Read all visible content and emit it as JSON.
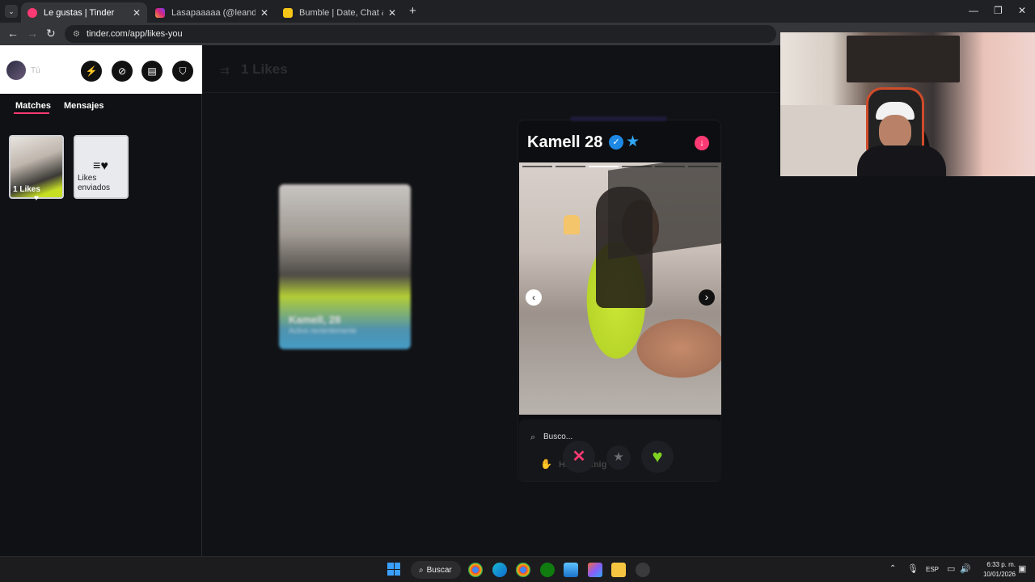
{
  "browser": {
    "tabs": [
      {
        "title": "Le gustas | Tinder",
        "active": true,
        "favicon_color": "#fd3a73"
      },
      {
        "title": "Lasapaaaaa (@leandroloaizam)",
        "active": false,
        "favicon_color": "#d62976"
      },
      {
        "title": "Bumble | Date, Chat & Meet Ne",
        "active": false,
        "favicon_color": "#f5c518"
      }
    ],
    "url": "tinder.com/app/likes-you",
    "new_tab_label": "+"
  },
  "sidebar": {
    "user_label": "Tú",
    "icons": [
      "bolt-icon",
      "compass-icon",
      "briefcase-icon",
      "shield-icon"
    ],
    "tabs": [
      {
        "label": "Matches",
        "active": true
      },
      {
        "label": "Mensajes",
        "active": false
      }
    ],
    "cards": [
      {
        "label": "1 Likes"
      },
      {
        "label": "Likes enviados"
      }
    ]
  },
  "main": {
    "likes_title": "1 Likes",
    "blurred_card": {
      "name": "Kamell, 28",
      "status": "Activo recientemente"
    }
  },
  "profile": {
    "name": "Kamell",
    "age": "28",
    "looking_for_label": "Busco...",
    "looking_for_value": "Hacer amig",
    "photo_segments": 6,
    "active_segment": 2,
    "colors": {
      "accent": "#fd3a73",
      "verified": "#1e88e5",
      "star": "#2fa7f5",
      "like": "#7ed321"
    }
  },
  "actions": {
    "nope_symbol": "✕",
    "superlike_symbol": "★",
    "like_symbol": "♥"
  },
  "taskbar": {
    "search_label": "Buscar",
    "language": "ESP",
    "time": "6:33 p. m.",
    "date": "10/01/2026"
  }
}
